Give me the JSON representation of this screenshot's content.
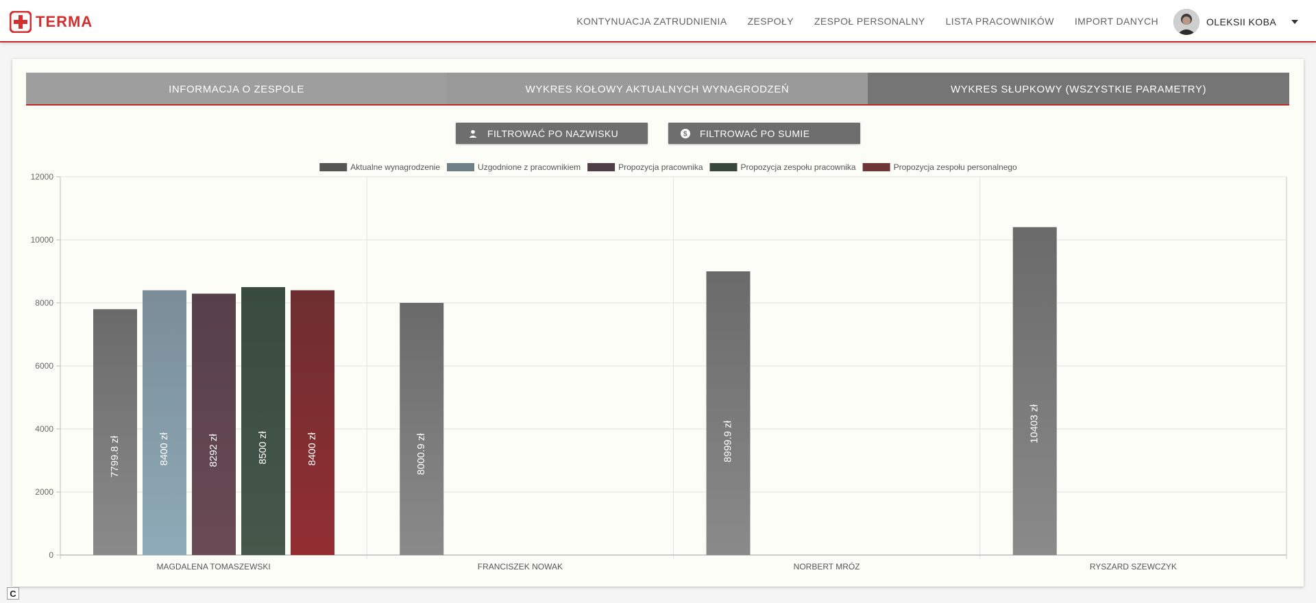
{
  "header": {
    "brand": "TERMA",
    "nav": [
      "KONTYNUACJA ZATRUDNIENIA",
      "ZESPOŁY",
      "ZESPOŁ PERSONALNY",
      "LISTA PRACOWNIKÓW",
      "IMPORT DANYCH"
    ],
    "user_name": "OLEKSII KOBA"
  },
  "tabs": [
    "INFORMACJA O ZESPOLE",
    "WYKRES KOŁOWY AKTUALNYCH WYNAGRODZEŃ",
    "WYKRES SŁUPKOWY (WSZYSTKIE PARAMETRY)"
  ],
  "active_tab": 2,
  "buttons": {
    "filter_name": "FILTROWAĆ PO NAZWISKU",
    "filter_sum": "FILTROWAĆ PO SUMIE"
  },
  "badge": "C",
  "chart_data": {
    "type": "bar",
    "categories": [
      "MAGDALENA TOMASZEWSKI",
      "FRANCISZEK NOWAK",
      "NORBERT MRÓZ",
      "RYSZARD SZEWCZYK"
    ],
    "series": [
      {
        "name": "Aktualne wynagrodzenie",
        "values": [
          7799.8,
          8000.9,
          8999.9,
          10403
        ],
        "color_top": "#6a6a6a",
        "color_bottom": "#8a8a8a",
        "legend_color": "#555555"
      },
      {
        "name": "Uzgodnione z pracownikiem",
        "values": [
          8400,
          null,
          null,
          null
        ],
        "color_top": "#7a8d98",
        "color_bottom": "#8eaab8",
        "legend_color": "#6f7f88"
      },
      {
        "name": "Propozycja pracownika",
        "values": [
          8292,
          null,
          null,
          null
        ],
        "color_top": "#55404a",
        "color_bottom": "#6a4a55",
        "legend_color": "#4f3e47"
      },
      {
        "name": "Propozycja zespołu pracownika",
        "values": [
          8500,
          null,
          null,
          null
        ],
        "color_top": "#394a3e",
        "color_bottom": "#45584b",
        "legend_color": "#37473c"
      },
      {
        "name": "Propozycja zespołu personalnego",
        "values": [
          8400,
          null,
          null,
          null
        ],
        "color_top": "#6d2e30",
        "color_bottom": "#922e32",
        "legend_color": "#6e3536"
      }
    ],
    "value_labels": [
      [
        "7799.8 zł",
        "8000.9 zł",
        "8999.9 zł",
        "10403 zł"
      ],
      [
        "8400 zł",
        null,
        null,
        null
      ],
      [
        "8292 zł",
        null,
        null,
        null
      ],
      [
        "8500 zł",
        null,
        null,
        null
      ],
      [
        "8400 zł",
        null,
        null,
        null
      ]
    ],
    "y_ticks": [
      "0",
      "2000",
      "4000",
      "6000",
      "8000",
      "10000",
      "12000"
    ],
    "ylim": [
      0,
      12000
    ],
    "legend_position": "top",
    "grid": true
  }
}
